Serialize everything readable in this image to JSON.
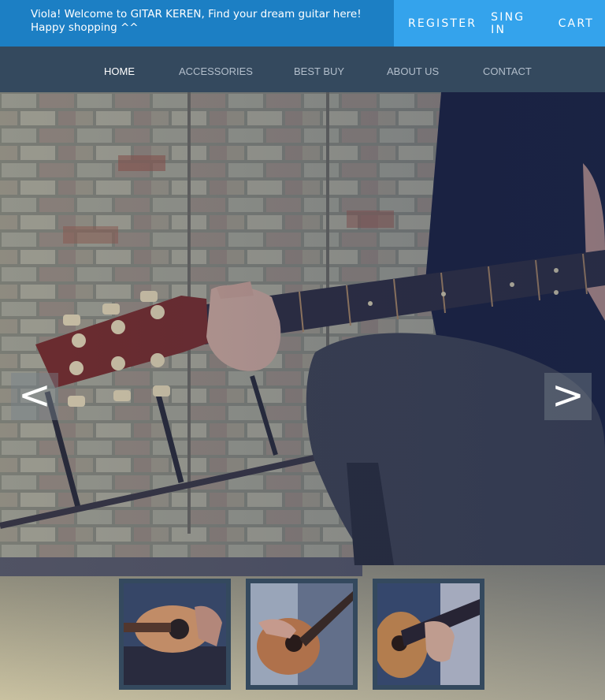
{
  "topbar": {
    "welcome_text": "Viola! Welcome to GITAR KEREN, Find your dream guitar here! Happy shopping ^^",
    "register": "REGISTER",
    "signin": "SING IN",
    "cart": "CART"
  },
  "nav": {
    "items": [
      {
        "label": "HOME",
        "active": true
      },
      {
        "label": "ACCESSORIES"
      },
      {
        "label": "BEST BUY"
      },
      {
        "label": "ABOUT US"
      },
      {
        "label": "CONTACT"
      }
    ]
  },
  "slider": {
    "prev_label": "<",
    "next_label": ">",
    "thumbnail_count": 3
  },
  "colors": {
    "welcome_bg": "#1c7fc4",
    "account_bg": "#34a3ec",
    "nav_bg": "#34495e",
    "nav_text": "#b3bfcc",
    "nav_active": "#ffffff"
  }
}
